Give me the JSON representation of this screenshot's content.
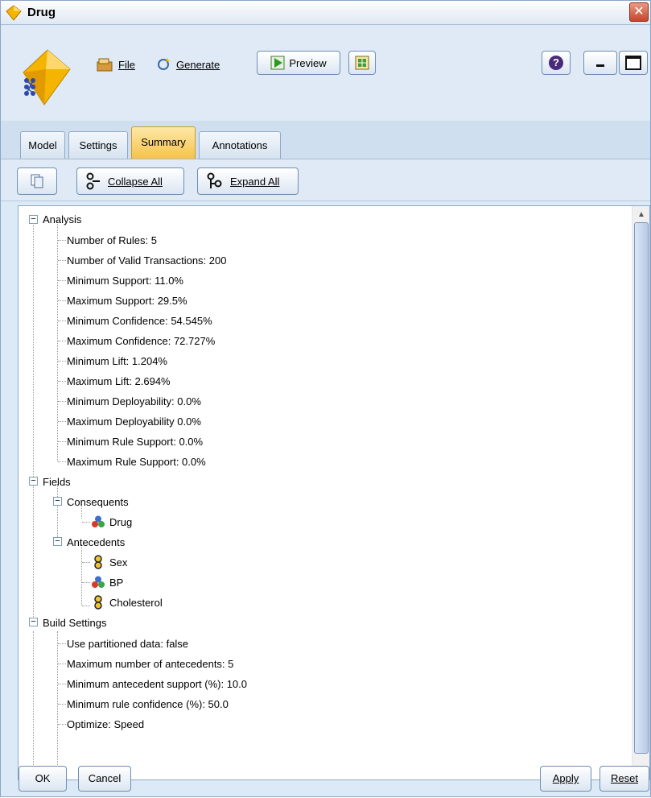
{
  "window": {
    "title": "Drug",
    "close_glyph": "✕"
  },
  "toolbar": {
    "file_label": "File",
    "generate_label": "Generate",
    "preview_label": "Preview",
    "help_glyph": "?"
  },
  "tabs": [
    {
      "label": "Model",
      "active": false
    },
    {
      "label": "Settings",
      "active": false
    },
    {
      "label": "Summary",
      "active": true
    },
    {
      "label": "Annotations",
      "active": false
    }
  ],
  "actions": {
    "collapse_label": "Collapse All",
    "expand_label": "Expand All"
  },
  "tree": {
    "analysis": {
      "label": "Analysis",
      "items": [
        "Number of Rules: 5",
        "Number of Valid Transactions: 200",
        "Minimum Support: 11.0%",
        "Maximum Support: 29.5%",
        "Minimum Confidence: 54.545%",
        "Maximum Confidence: 72.727%",
        "Minimum Lift: 1.204%",
        "Maximum Lift: 2.694%",
        "Minimum Deployability: 0.0%",
        "Maximum Deployability 0.0%",
        "Minimum Rule Support: 0.0%",
        "Maximum Rule Support: 0.0%"
      ]
    },
    "fields": {
      "label": "Fields",
      "consequents_label": "Consequents",
      "consequents": [
        {
          "label": "Drug",
          "icon": "set-field-icon"
        }
      ],
      "antecedents_label": "Antecedents",
      "antecedents": [
        {
          "label": "Sex",
          "icon": "flag-field-icon"
        },
        {
          "label": "BP",
          "icon": "set-field-icon"
        },
        {
          "label": "Cholesterol",
          "icon": "flag-field-icon"
        }
      ]
    },
    "build_settings": {
      "label": "Build Settings",
      "items": [
        "Use partitioned data: false",
        "Maximum number of antecedents: 5",
        "Minimum antecedent support (%): 10.0",
        "Minimum rule confidence (%): 50.0",
        "Optimize: Speed"
      ]
    }
  },
  "buttons": {
    "ok": "OK",
    "cancel": "Cancel",
    "apply": "Apply",
    "reset": "Reset"
  },
  "colors": {
    "active_tab": "#f6c24b",
    "window_bg": "#dce9f7",
    "accent_border": "#6f8db3"
  }
}
